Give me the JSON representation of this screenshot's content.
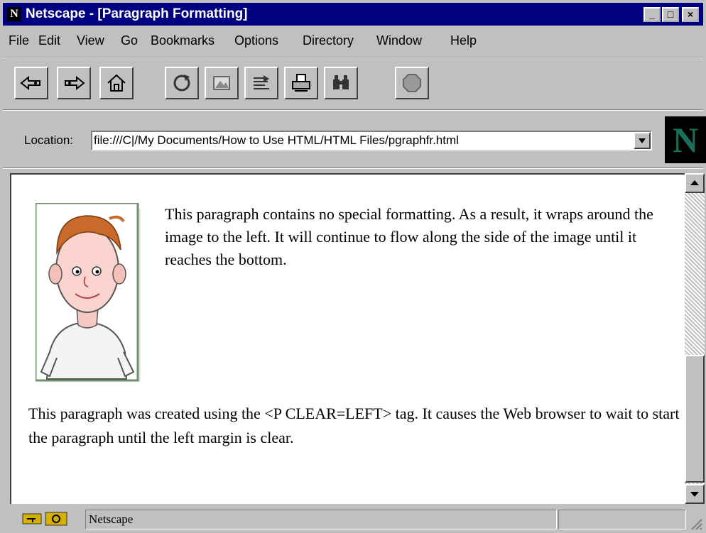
{
  "window": {
    "title": "Netscape - [Paragraph Formatting]",
    "app_icon": "netscape-n-icon"
  },
  "menubar": {
    "items": [
      {
        "label": "File"
      },
      {
        "label": "Edit"
      },
      {
        "label": "View"
      },
      {
        "label": "Go"
      },
      {
        "label": "Bookmarks"
      },
      {
        "label": "Options"
      },
      {
        "label": "Directory"
      },
      {
        "label": "Window"
      },
      {
        "label": "Help"
      }
    ]
  },
  "toolbar": {
    "buttons": [
      {
        "icon": "back-arrow-icon"
      },
      {
        "icon": "forward-arrow-icon"
      },
      {
        "icon": "home-icon"
      },
      {
        "icon": "reload-icon"
      },
      {
        "icon": "images-icon"
      },
      {
        "icon": "open-icon"
      },
      {
        "icon": "print-icon"
      },
      {
        "icon": "find-icon"
      },
      {
        "icon": "stop-icon"
      }
    ]
  },
  "location": {
    "label": "Location:",
    "url": "file:///C|/My Documents/How to Use HTML/HTML Files/pgraphfr.html"
  },
  "brand": {
    "letter": "N"
  },
  "content": {
    "paragraph1": "This paragraph contains no special formatting. As a result, it wraps around the image to the left. It will continue to flow along the side of the image until it reaches the bottom.",
    "paragraph2": "This paragraph was created using the <P CLEAR=LEFT> tag. It causes the Web browser to wait to start the paragraph until the left margin is clear."
  },
  "statusbar": {
    "text": "Netscape"
  }
}
